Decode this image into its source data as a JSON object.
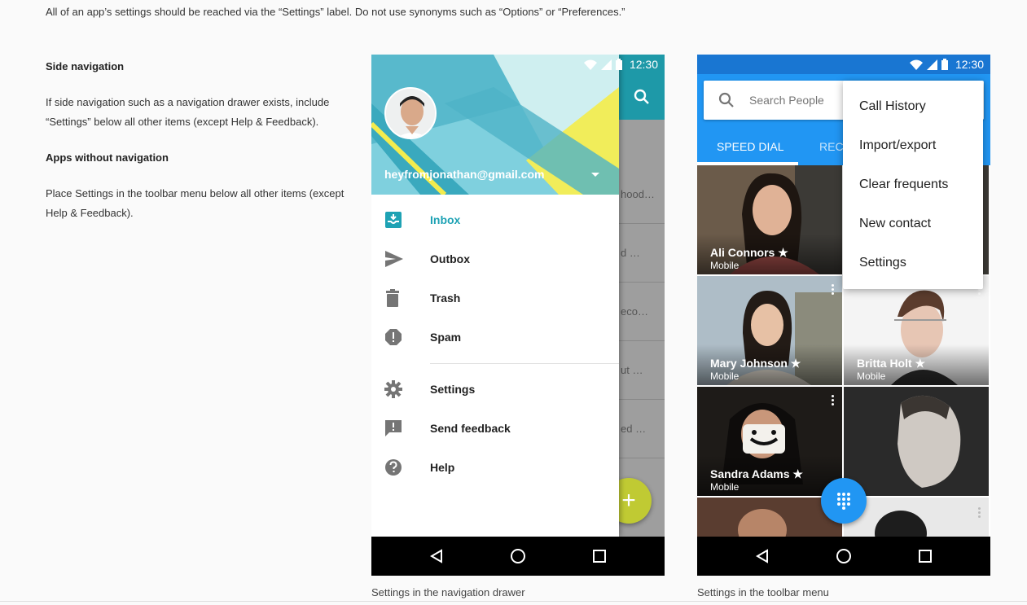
{
  "intro_text": "All of an app’s settings should be reached via the “Settings” label. Do not use synonyms such as “Options” or “Preferences.”",
  "left": {
    "side_nav_title": "Side navigation",
    "side_nav_body": "If side navigation such as a navigation drawer exists, include “Settings” below all other items (except Help & Feedback).",
    "no_nav_title": "Apps without navigation",
    "no_nav_body": "Place Settings in the toolbar menu below all other items (except Help & Feedback)."
  },
  "phone1": {
    "time": "12:30",
    "email": "heyfromjonathan@gmail.com",
    "bg_rows": [
      "hood…",
      "d …",
      "eco…",
      "ut …",
      "ed …"
    ],
    "items": [
      {
        "label": "Inbox",
        "icon": "inbox-icon"
      },
      {
        "label": "Outbox",
        "icon": "send-icon"
      },
      {
        "label": "Trash",
        "icon": "trash-icon"
      },
      {
        "label": "Spam",
        "icon": "alert-icon"
      },
      {
        "label": "Settings",
        "icon": "gear-icon"
      },
      {
        "label": "Send feedback",
        "icon": "feedback-icon"
      },
      {
        "label": "Help",
        "icon": "help-icon"
      }
    ],
    "caption": "Settings in the navigation drawer"
  },
  "phone2": {
    "time": "12:30",
    "search_placeholder": "Search People  &",
    "tabs": [
      "SPEED DIAL",
      "RECE"
    ],
    "contacts": [
      {
        "name": "Ali Connors ★",
        "type": "Mobile"
      },
      {
        "name": "Mary Johnson ★",
        "type": "Mobile"
      },
      {
        "name": "Britta Holt ★",
        "type": "Mobile"
      },
      {
        "name": "Sandra Adams ★",
        "type": "Mobile"
      }
    ],
    "menu": [
      "Call History",
      "Import/export",
      "Clear frequents",
      "New contact",
      "Settings"
    ],
    "caption": "Settings in the toolbar menu"
  },
  "colors": {
    "teal": "#1ea2b4",
    "blue": "#2196f3",
    "fab_green": "#c0ca33"
  }
}
